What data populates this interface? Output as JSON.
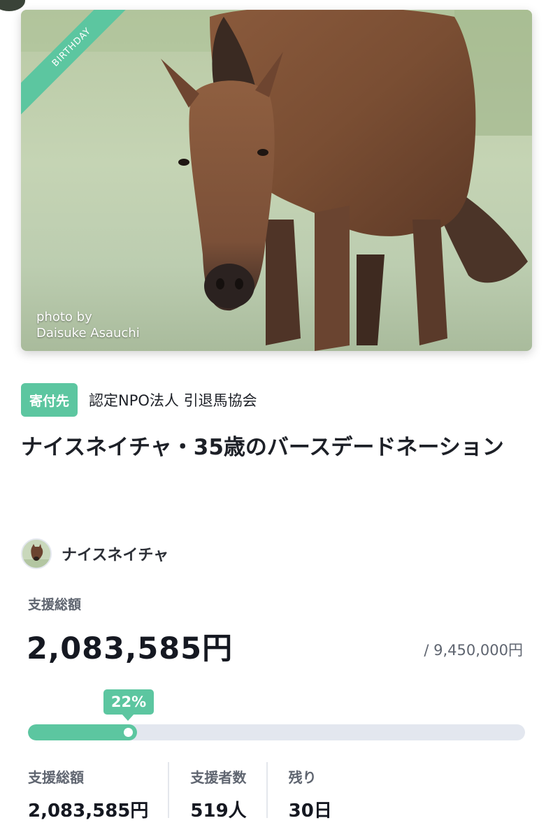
{
  "hero": {
    "ribbon_label": "BIRTHDAY",
    "photo_credit_line1": "photo by",
    "photo_credit_line2": "Daisuke Asauchi"
  },
  "organization": {
    "badge_label": "寄付先",
    "name": "認定NPO法人 引退馬協会"
  },
  "project": {
    "title": "ナイスネイチャ・35歳のバースデードネーション"
  },
  "owner": {
    "name": "ナイスネイチャ"
  },
  "funding": {
    "total_label": "支援総額",
    "total_amount": "2,083,585円",
    "goal": "/ 9,450,000円",
    "percent_label": "22%",
    "progress_fraction": 0.22
  },
  "stats": [
    {
      "label": "支援総額",
      "value": "2,083,585円"
    },
    {
      "label": "支援者数",
      "value": "519人"
    },
    {
      "label": "残り",
      "value": "30日"
    }
  ],
  "colors": {
    "accent": "#5cc6a0",
    "track": "#e3e7ef",
    "text_primary": "#1d2027",
    "text_secondary": "#5f6570"
  }
}
